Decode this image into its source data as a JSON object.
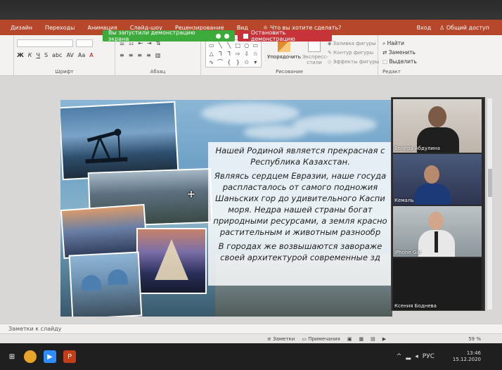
{
  "share": {
    "message": "Вы запустили демонстрацию экрана",
    "stop_label": "Остановить демонстрацию"
  },
  "tabs": [
    "Дизайн",
    "Переходы",
    "Анимация",
    "Слайд-шоу",
    "Рецензирование",
    "Вид"
  ],
  "tell_me": "Что вы хотите сделать?",
  "account": {
    "login": "Вход",
    "share": "Общий доступ"
  },
  "ribbon": {
    "font_group": "Шрифт",
    "paragraph_group": "Абзац",
    "drawing_group": "Рисование",
    "edit_group": "Редакт",
    "arrange": "Упорядочить",
    "express_styles": "Экспресс-стили",
    "shape_fill": "Заливка фигуры",
    "shape_outline": "Контур фигуры",
    "shape_effects": "Эффекты фигуры",
    "find": "Найти",
    "replace": "Заменить",
    "select": "Выделить"
  },
  "slide": {
    "text1": "Нашей Родиной является прекрасная с",
    "text1b": "Республика Казахстан.",
    "text2a": "Являясь сердцем Евразии, наше госуда",
    "text2b": "распласталось от самого подножия",
    "text2c": "Шаньских гор до удивительного Каспи",
    "text2d": "моря. Недра нашей страны богат",
    "text2e": "природными ресурсами, а земля красно",
    "text2f": "растительным и животным разнообр",
    "text3a": "В городах же возвышаются завораже",
    "text3b": "своей архитектурой современные зд"
  },
  "participants": [
    {
      "name": "Венера Абдулина"
    },
    {
      "name": "Кемаль"
    },
    {
      "name": "iPhone Gar"
    },
    {
      "name": "Ксения Боднева"
    }
  ],
  "notes_label": "Заметки к слайду",
  "status": {
    "notes": "Заметки",
    "comments": "Примечания",
    "zoom": "59 %"
  },
  "tray": {
    "lang": "РУС",
    "time": "13:46",
    "date": "15.12.2020"
  },
  "colors": {
    "accent": "#b7472a",
    "share_green": "#3cab3c",
    "share_red": "#c6343a"
  }
}
